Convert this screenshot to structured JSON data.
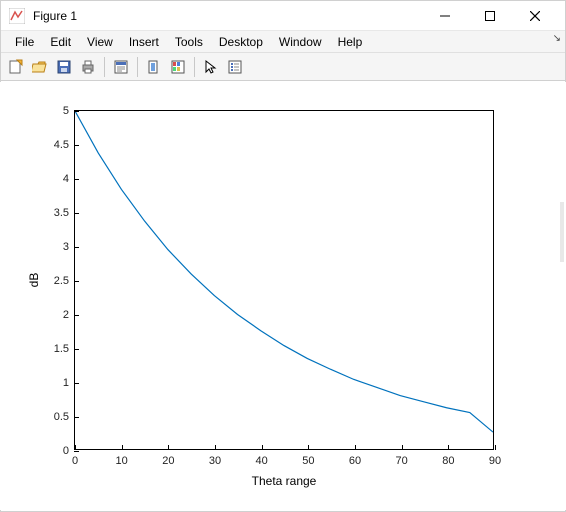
{
  "window": {
    "title": "Figure 1"
  },
  "menu": {
    "items": [
      "File",
      "Edit",
      "View",
      "Insert",
      "Tools",
      "Desktop",
      "Window",
      "Help"
    ]
  },
  "toolbar": {
    "new": "New Figure",
    "open": "Open",
    "save": "Save",
    "print": "Print",
    "printpreview": "Print Preview",
    "link": "Link",
    "colorbar": "Insert Colorbar",
    "cursor": "Edit Plot",
    "legend": "Insert Legend"
  },
  "chart_data": {
    "type": "line",
    "xlabel": "Theta range",
    "ylabel": "dB",
    "xlim": [
      0,
      90
    ],
    "ylim": [
      0,
      5
    ],
    "xticks": [
      0,
      10,
      20,
      30,
      40,
      50,
      60,
      70,
      80,
      90
    ],
    "yticks": [
      0,
      0.5,
      1,
      1.5,
      2,
      2.5,
      3,
      3.5,
      4,
      4.5,
      5
    ],
    "x": [
      0,
      5,
      10,
      15,
      20,
      25,
      30,
      35,
      40,
      45,
      50,
      55,
      60,
      65,
      70,
      75,
      80,
      85,
      90
    ],
    "y": [
      5.0,
      4.38,
      3.84,
      3.37,
      2.95,
      2.59,
      2.27,
      1.99,
      1.75,
      1.53,
      1.34,
      1.18,
      1.03,
      0.91,
      0.79,
      0.7,
      0.61,
      0.54,
      0.25
    ],
    "line_color": "#0072BD"
  }
}
